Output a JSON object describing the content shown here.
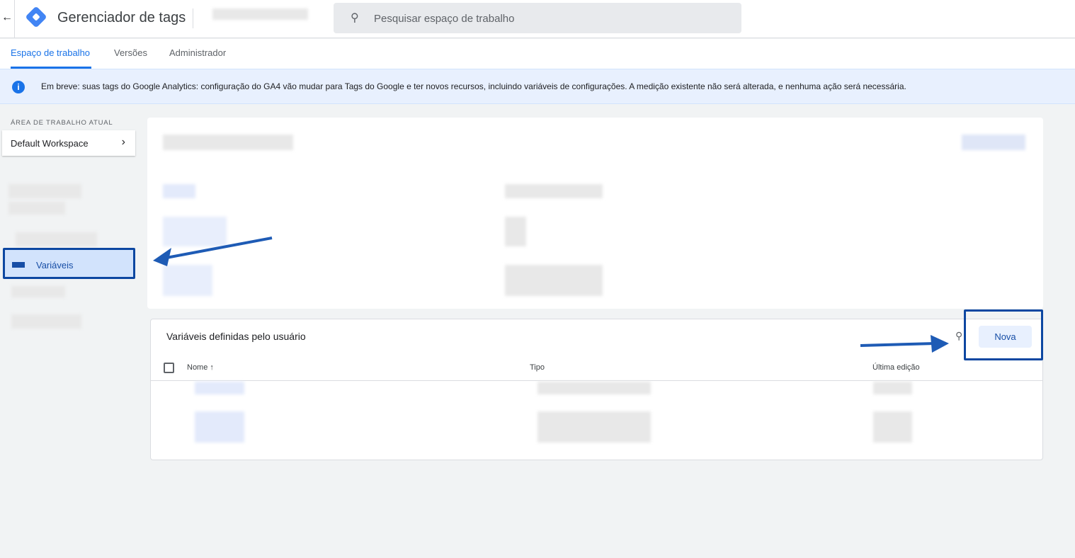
{
  "header": {
    "title": "Gerenciador de tags",
    "search_placeholder": "Pesquisar espaço de trabalho"
  },
  "tabs": [
    {
      "label": "Espaço de trabalho"
    },
    {
      "label": "Versões"
    },
    {
      "label": "Administrador"
    }
  ],
  "banner": {
    "text": "Em breve: suas tags do Google Analytics: configuração do GA4 vão mudar para Tags do Google e ter novos recursos, incluindo variáveis de configurações. A medição existente não será alterada, e nenhuma ação será necessária."
  },
  "sidebar": {
    "workspace_label": "ÁREA DE TRABALHO ATUAL",
    "workspace": "Default Workspace",
    "selected_item": "Variáveis"
  },
  "user_vars": {
    "title": "Variáveis definidas pelo usuário",
    "new_button": "Nova",
    "columns": [
      "Nome",
      "Tipo",
      "Última edição"
    ]
  },
  "colors": {
    "accent": "#1a73e8",
    "annotation": "#0d47a1"
  }
}
